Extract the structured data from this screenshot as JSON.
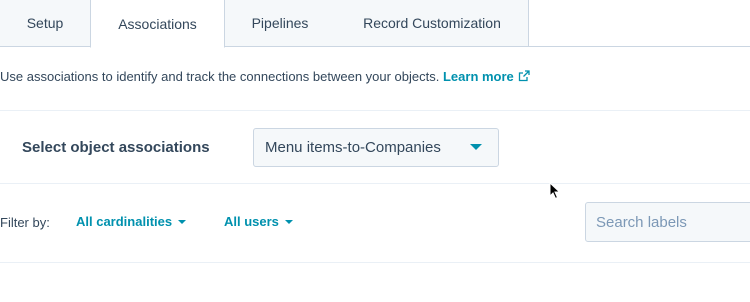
{
  "tabs": [
    {
      "label": "Setup"
    },
    {
      "label": "Associations"
    },
    {
      "label": "Pipelines"
    },
    {
      "label": "Record Customization"
    }
  ],
  "intro": {
    "text": "Use associations to identify and track the connections between your objects.",
    "learn_more": "Learn more",
    "learn_more_icon": "external-link-icon"
  },
  "associations": {
    "label": "Select object associations",
    "selected": "Menu items-to-Companies"
  },
  "filters": {
    "label": "Filter by:",
    "cardinality": "All cardinalities",
    "users": "All users"
  },
  "search": {
    "placeholder": "Search labels"
  },
  "colors": {
    "accent": "#0091ae",
    "text": "#33475b",
    "border": "#cbd6e2",
    "tab_bg": "#f5f8fa"
  }
}
